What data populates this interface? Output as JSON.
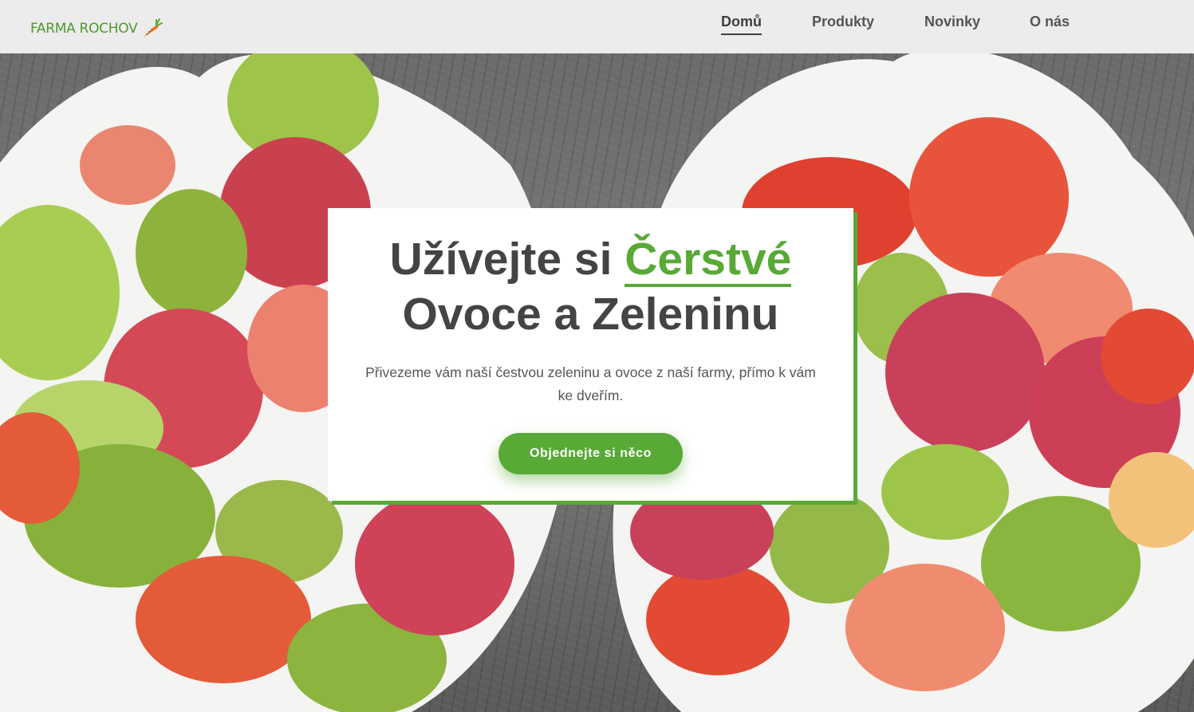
{
  "header": {
    "logo_text": "FARMA ROCHOV",
    "nav": [
      {
        "label": "Domů",
        "active": true
      },
      {
        "label": "Produkty",
        "active": false
      },
      {
        "label": "Novinky",
        "active": false
      },
      {
        "label": "O nás",
        "active": false
      }
    ]
  },
  "hero": {
    "headline_part1": "Užívejte si ",
    "headline_accent": "Čerstvé",
    "headline_line2": "Ovoce a Zeleninu",
    "subtitle": "Přivezeme vám naší čestvou zeleninu a ovoce z naší farmy, přímo k vám ke dveřím.",
    "cta_label": "Objednejte si něco",
    "background_icon": "fruit-salad-bowls-image"
  },
  "colors": {
    "accent": "#58a936",
    "header_bg": "#ececec",
    "text_dark": "#444444"
  }
}
